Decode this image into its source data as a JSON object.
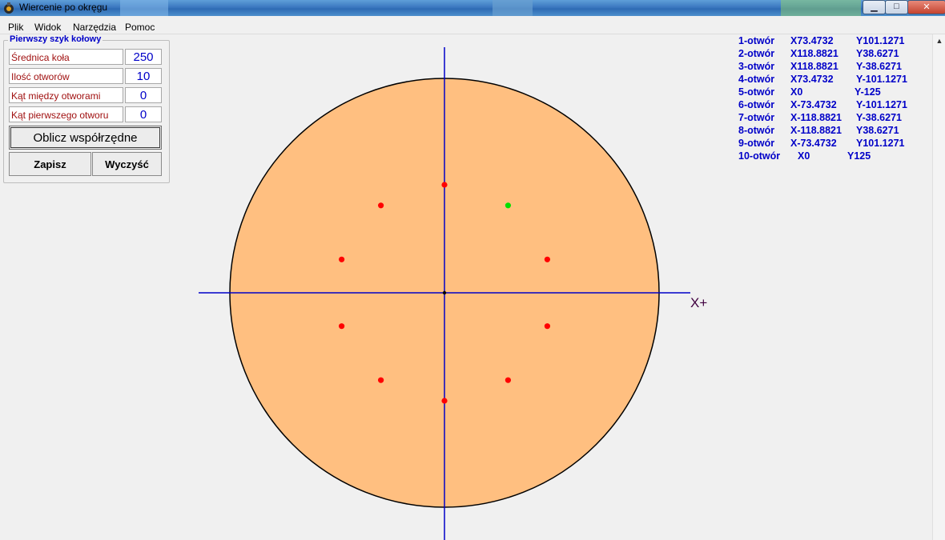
{
  "window": {
    "title": "Wiercenie po okręgu"
  },
  "menu": [
    "Plik",
    "Widok",
    "Narzędzia",
    "Pomoc"
  ],
  "group": {
    "title": "Pierwszy szyk kołowy",
    "fields": [
      {
        "label": "Średnica koła",
        "value": "250"
      },
      {
        "label": "Ilość otworów",
        "value": "10"
      },
      {
        "label": "Kąt między otworami",
        "value": "0"
      },
      {
        "label": "Kąt pierwszego otworu",
        "value": "0"
      }
    ],
    "calc_label": "Oblicz współrzędne",
    "save_label": "Zapisz",
    "clear_label": "Wyczyść"
  },
  "coords": [
    {
      "name": "1-otwór",
      "x": "X73.4732",
      "y": "Y101.1271"
    },
    {
      "name": "2-otwór",
      "x": "X118.8821",
      "y": "Y38.6271"
    },
    {
      "name": "3-otwór",
      "x": "X118.8821",
      "y": "Y-38.6271"
    },
    {
      "name": "4-otwór",
      "x": "X73.4732",
      "y": "Y-101.1271"
    },
    {
      "name": "5-otwór",
      "x": "X0",
      "y": "Y-125"
    },
    {
      "name": "6-otwór",
      "x": "X-73.4732",
      "y": "Y-101.1271"
    },
    {
      "name": "7-otwór",
      "x": "X-118.8821",
      "y": "Y-38.6271"
    },
    {
      "name": "8-otwór",
      "x": "X-118.8821",
      "y": "Y38.6271"
    },
    {
      "name": "9-otwór",
      "x": "X-73.4732",
      "y": "Y101.1271"
    },
    {
      "name": "10-otwór",
      "x": "X0",
      "y": "Y125"
    }
  ],
  "axis_label": "X+",
  "colors": {
    "disc_fill": "#ffbf80",
    "axis": "#0000c8",
    "hole": "#ff0000",
    "current_hole": "#00e000",
    "text_blue": "#0000c8",
    "label_red": "#a01010"
  }
}
